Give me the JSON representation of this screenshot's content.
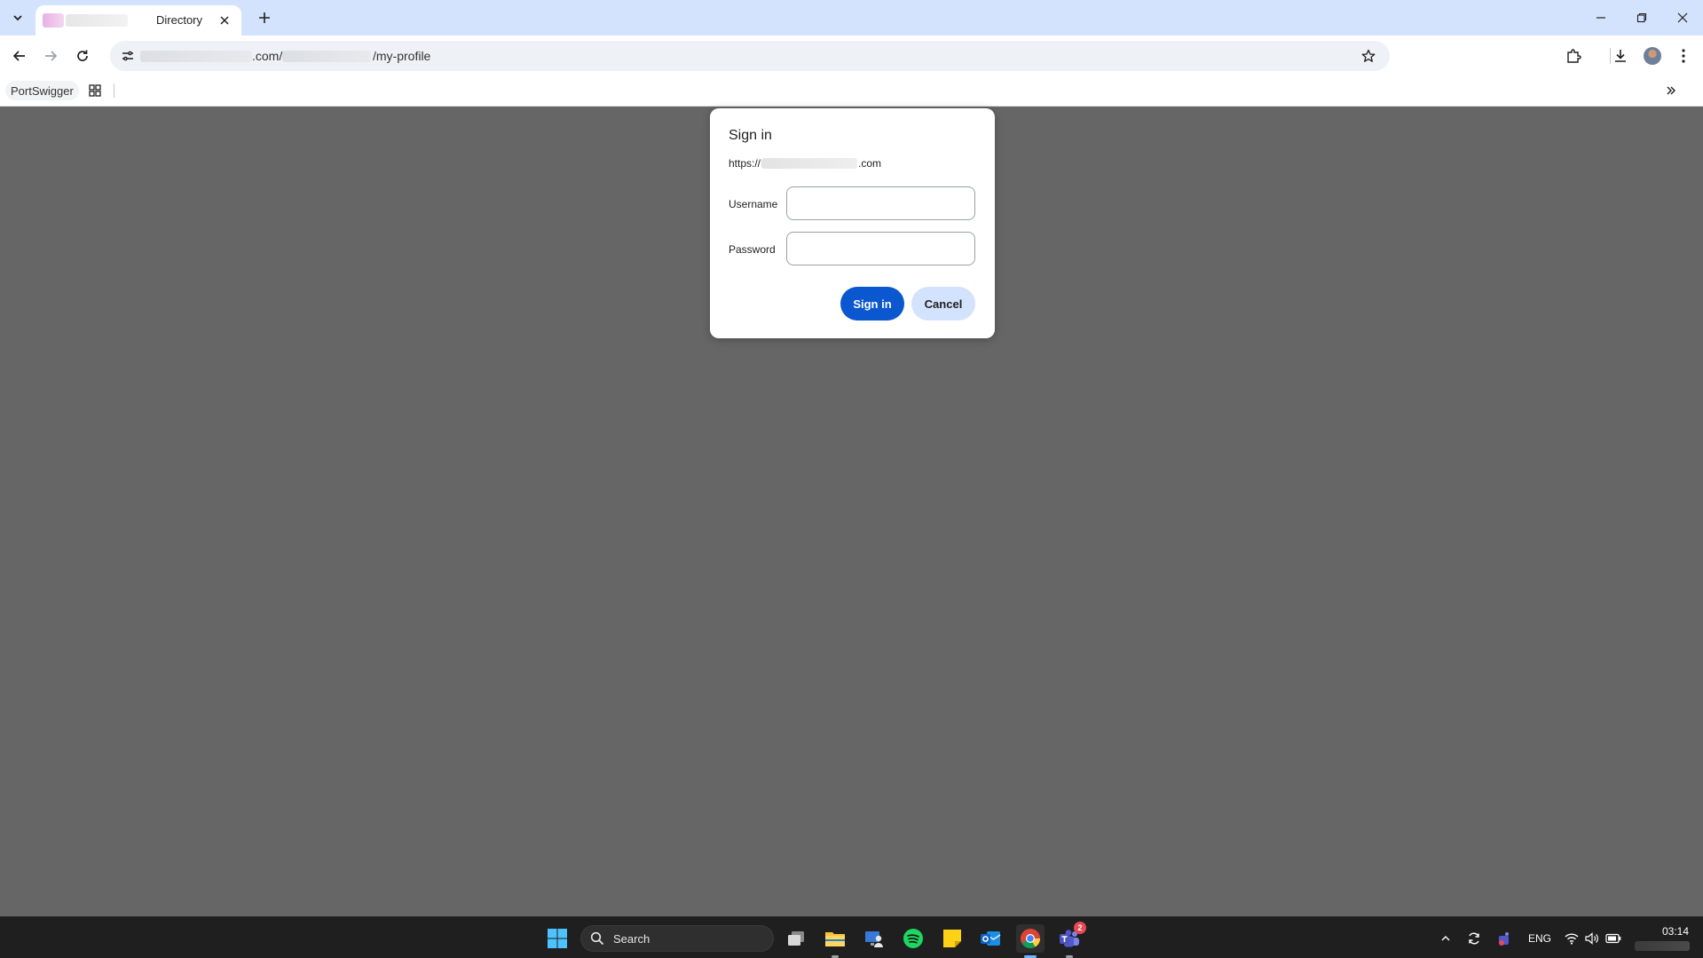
{
  "browser": {
    "tab": {
      "title": "Directory"
    },
    "address": {
      "domain_suffix": ".com/",
      "path": "/my-profile"
    },
    "bookmarks": [
      {
        "label": "PortSwigger"
      }
    ]
  },
  "dialog": {
    "title": "Sign in",
    "origin_prefix": "https://",
    "origin_suffix": ".com",
    "username_label": "Username",
    "password_label": "Password",
    "username_value": "",
    "password_value": "",
    "sign_in_label": "Sign in",
    "cancel_label": "Cancel",
    "primary_color": "#0b57d0"
  },
  "taskbar": {
    "search_label": "Search",
    "teams_badge": "2",
    "language": "ENG",
    "time": "03:14"
  },
  "colors": {
    "tabstrip": "#d3e3fd",
    "overlay": "#666666",
    "taskbar": "#1f1f1f"
  }
}
